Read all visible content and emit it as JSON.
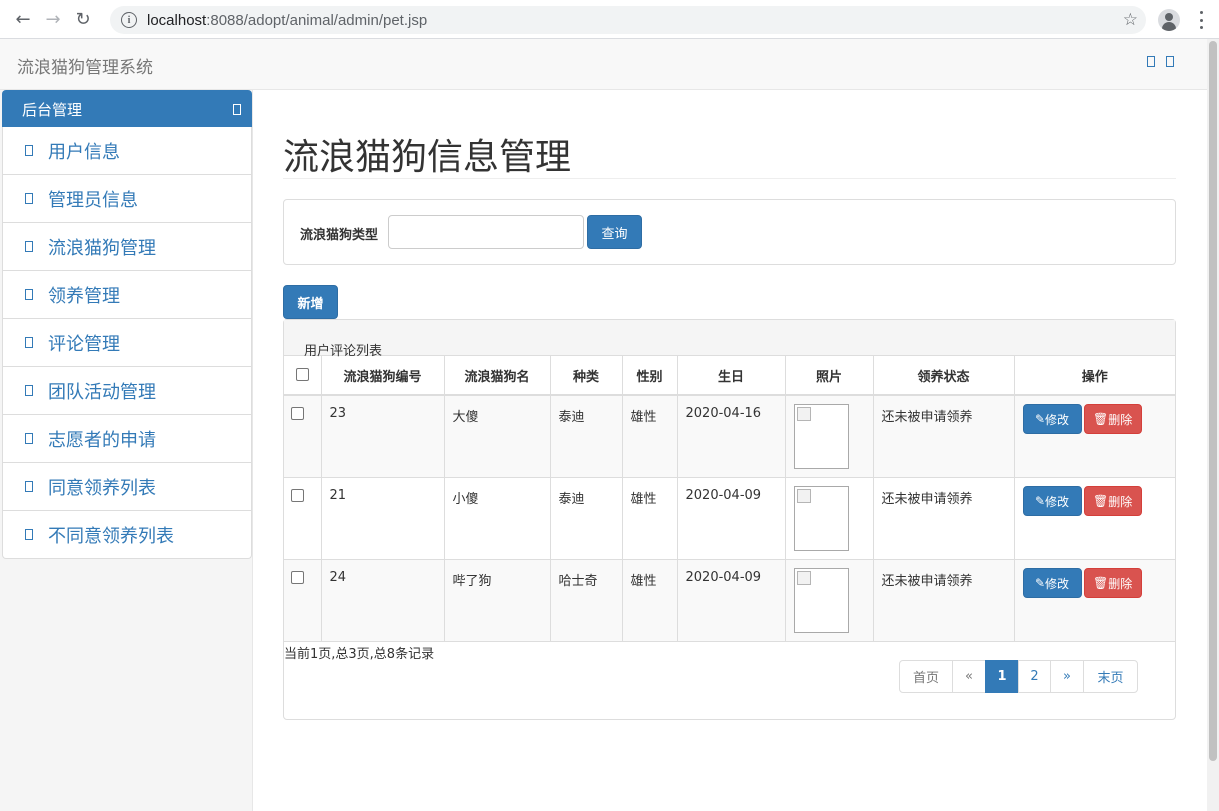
{
  "browser": {
    "url_host": "localhost",
    "url_path": ":8088/adopt/animal/admin/pet.jsp"
  },
  "navbar": {
    "brand": "流浪猫狗管理系统"
  },
  "sidebar": {
    "heading": "后台管理",
    "items": [
      {
        "label": "用户信息"
      },
      {
        "label": "管理员信息"
      },
      {
        "label": "流浪猫狗管理"
      },
      {
        "label": "领养管理"
      },
      {
        "label": "评论管理"
      },
      {
        "label": "团队活动管理"
      },
      {
        "label": "志愿者的申请"
      },
      {
        "label": "同意领养列表"
      },
      {
        "label": "不同意领养列表"
      }
    ]
  },
  "main": {
    "title": "流浪猫狗信息管理",
    "search": {
      "label": "流浪猫狗类型",
      "value": "",
      "button": "查询"
    },
    "add_button": "新增",
    "list_heading": "用户评论列表",
    "columns": [
      "流浪猫狗编号",
      "流浪猫狗名",
      "种类",
      "性别",
      "生日",
      "照片",
      "领养状态",
      "操作"
    ],
    "rows": [
      {
        "id": "23",
        "name": "大傻",
        "kind": "泰迪",
        "sex": "雄性",
        "birthday": "2020-04-16",
        "status": "还未被申请领养"
      },
      {
        "id": "21",
        "name": "小傻",
        "kind": "泰迪",
        "sex": "雄性",
        "birthday": "2020-04-09",
        "status": "还未被申请领养"
      },
      {
        "id": "24",
        "name": "哔了狗",
        "kind": "哈士奇",
        "sex": "雄性",
        "birthday": "2020-04-09",
        "status": "还未被申请领养"
      }
    ],
    "edit_label": "修改",
    "delete_label": "删除",
    "page_info": "当前1页,总3页,总8条记录",
    "pagination": {
      "first": "首页",
      "prev": "«",
      "pages": [
        "1",
        "2"
      ],
      "current": "1",
      "next": "»",
      "last": "末页"
    }
  },
  "colors": {
    "primary": "#337ab7",
    "danger": "#d9534f"
  }
}
